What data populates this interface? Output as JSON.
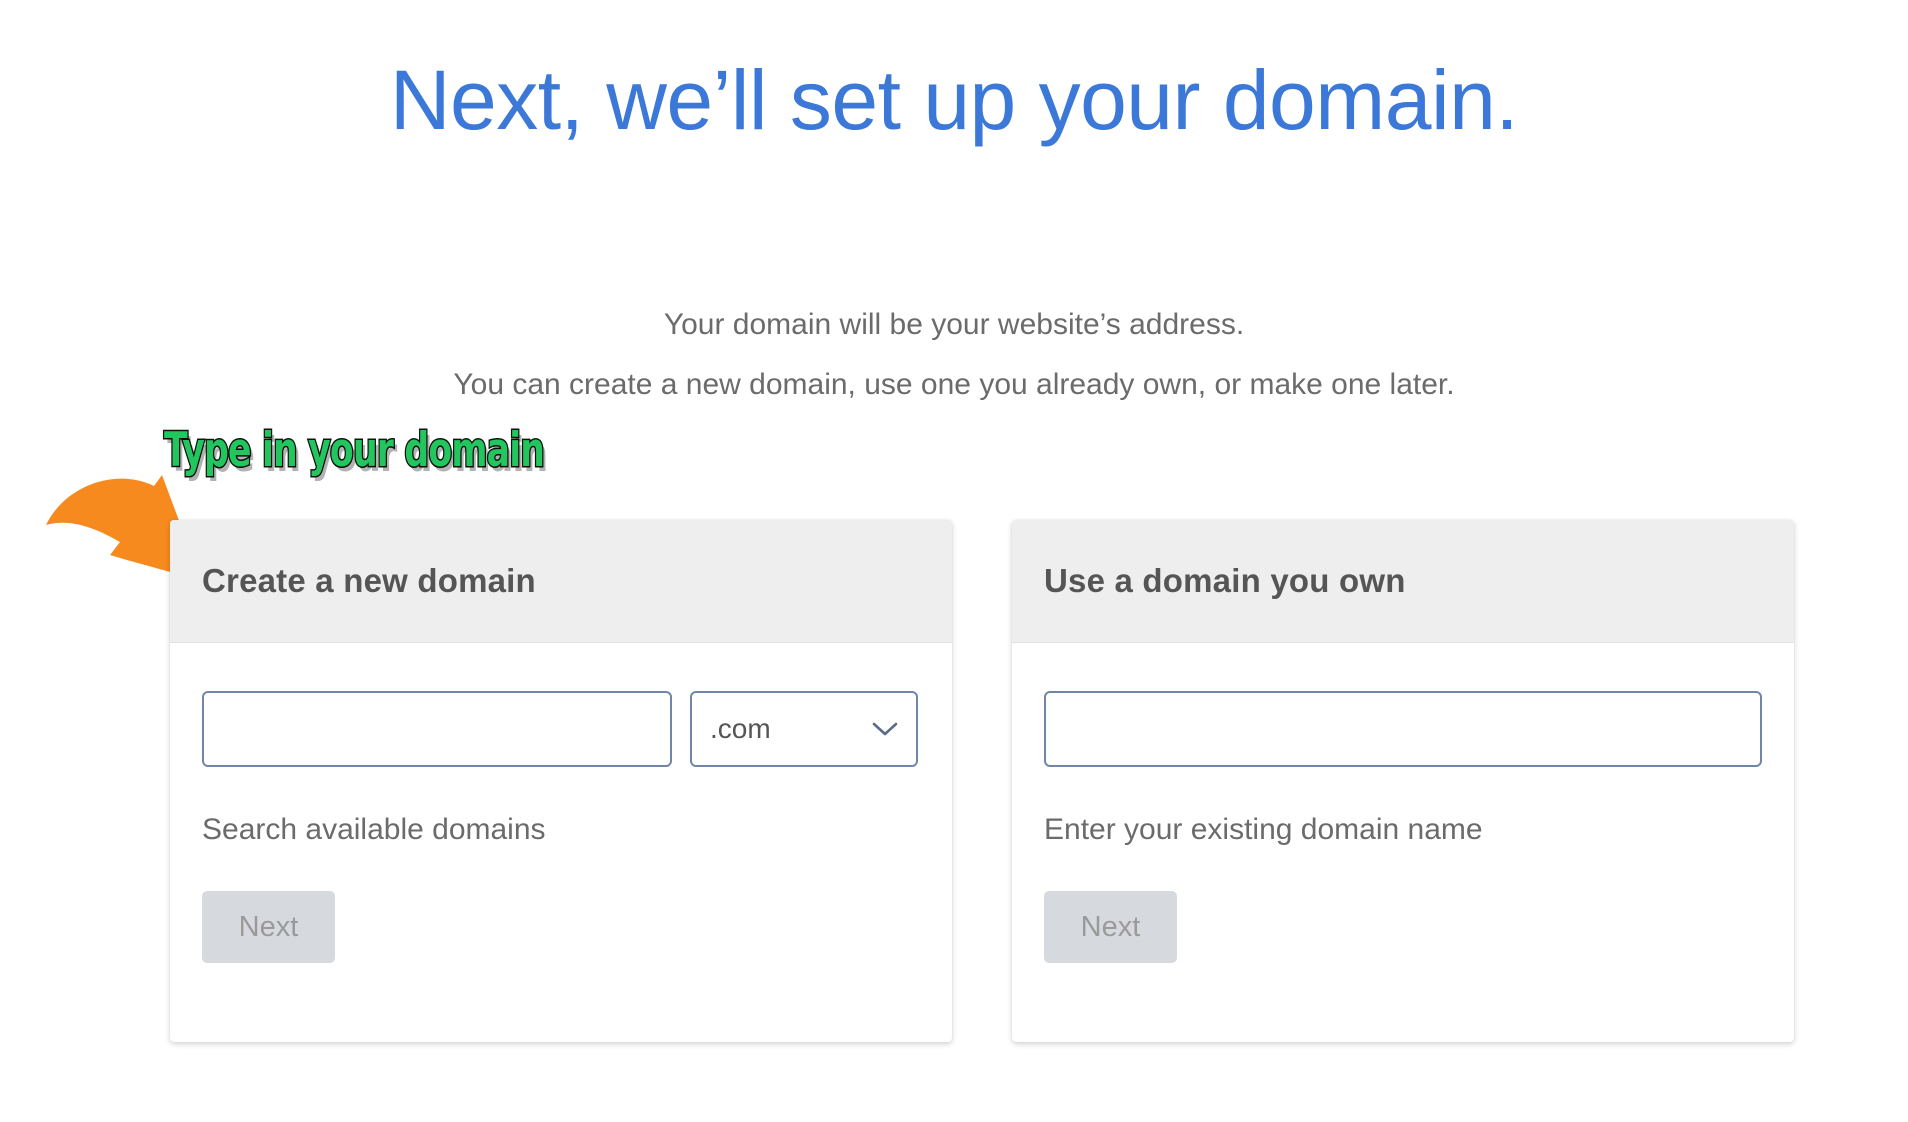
{
  "page": {
    "title": "Next, we’ll set up your domain.",
    "title_color": "#3c78d8",
    "subtitle_line1": "Your domain will be your website’s address.",
    "subtitle_line2": "You can create a new domain, use one you already own, or make one later."
  },
  "annotation": {
    "text": "Type in your domain",
    "text_color": "#22c55e",
    "outline_color": "#111111",
    "arrow_icon": "curved-arrow-down-right-icon",
    "arrow_color": "#f78a1e"
  },
  "cards": {
    "create_new": {
      "header": "Create a new domain",
      "domain_input": {
        "value": "",
        "placeholder": ""
      },
      "tld_select": {
        "value": ".com",
        "chevron_icon": "chevron-down-icon"
      },
      "helper_label": "Search available domains",
      "next_label": "Next"
    },
    "use_own": {
      "header": "Use a domain you own",
      "domain_input": {
        "value": "",
        "placeholder": ""
      },
      "helper_label": "Enter your existing domain name",
      "next_label": "Next"
    }
  },
  "colors": {
    "accent_blue": "#3c78d8",
    "input_border": "#7086a8",
    "card_header_bg": "#eeeeee",
    "button_disabled_bg": "#d6dadf",
    "button_disabled_text": "#9a9a9a",
    "body_text": "#6b6b6b"
  }
}
